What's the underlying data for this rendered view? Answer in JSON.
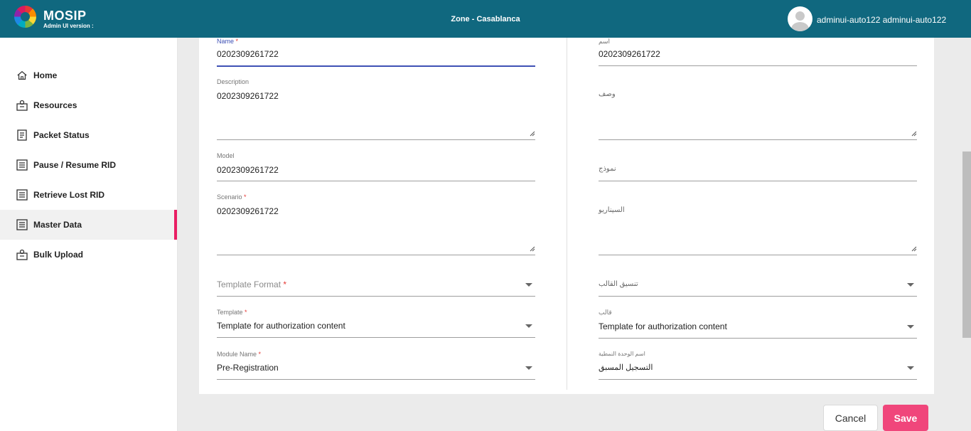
{
  "header": {
    "brand": "MOSIP",
    "version": "Admin UI version :",
    "zone": "Zone - Casablanca",
    "user": "adminui-auto122 adminui-auto122"
  },
  "sidebar": {
    "items": [
      {
        "label": "Home",
        "icon": "home-icon"
      },
      {
        "label": "Resources",
        "icon": "resources-icon"
      },
      {
        "label": "Packet Status",
        "icon": "packet-icon"
      },
      {
        "label": "Pause / Resume RID",
        "icon": "list-icon"
      },
      {
        "label": "Retrieve Lost RID",
        "icon": "list-icon"
      },
      {
        "label": "Master Data",
        "icon": "list-icon",
        "active": true
      },
      {
        "label": "Bulk Upload",
        "icon": "upload-icon"
      }
    ]
  },
  "form_left": {
    "name_label": "Name",
    "name_value": "0202309261722",
    "description_label": "Description",
    "description_value": "0202309261722",
    "model_label": "Model",
    "model_value": "0202309261722",
    "scenario_label": "Scenario",
    "scenario_value": "0202309261722",
    "template_format_placeholder": "Template Format",
    "template_label": "Template",
    "template_value": "Template for authorization content",
    "module_label": "Module Name",
    "module_value": "Pre-Registration",
    "required_mark": "*"
  },
  "form_right": {
    "name_label": "اسم",
    "name_value": "0202309261722",
    "description_placeholder": "وصف",
    "model_placeholder": "نموذج",
    "scenario_placeholder": "السيناريو",
    "template_format_placeholder": "تنسيق القالب",
    "template_label": "قالب",
    "template_value": "Template for authorization content",
    "module_label": "اسم الوحدة النمطية",
    "module_value": "التسجيل المسبق"
  },
  "footer": {
    "cancel_label": "Cancel",
    "save_label": "Save"
  },
  "colors": {
    "header_bg": "#10687f",
    "accent": "#e91e63",
    "save_bg": "#f0467b",
    "focus_underline": "#3f51b5"
  }
}
